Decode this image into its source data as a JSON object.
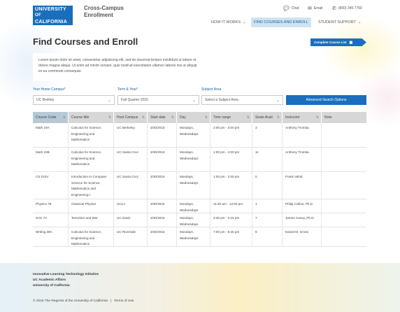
{
  "header": {
    "logo_line1": "UNIVERSITY",
    "logo_line2": "OF",
    "logo_line3": "CALIFORNIA",
    "site_title": "Cross-Campus Enrollment",
    "utility": {
      "chat": "Chat",
      "email": "Email",
      "phone": "(800) 345 7760"
    },
    "nav": [
      {
        "label": "HOW IT WORKS"
      },
      {
        "label": "FIND COURSES AND ENROLL"
      },
      {
        "label": "STUDENT SUPPORT"
      }
    ]
  },
  "page_title": "Find Courses and Enroll",
  "complete_course_list_label": "Complete Course List",
  "intro_text": "Lorem ipsum dolor sit amet, consectetur adipisicing elit, sed do eiusmod tempor incididunt ut labore et dolore magna aliqua. Ut enim ad minim veniam, quis nostrud exercitation ullamco laboris nisi ut aliquip ex ea commodo consequat.",
  "filters": {
    "home_campus": {
      "label": "Your Home Campus*",
      "value": "UC Berkley"
    },
    "term_year": {
      "label": "Term & Year*",
      "value": "Fall Quarter 2015"
    },
    "subject_area": {
      "label": "Subject Area",
      "value": "Select a Subject Area"
    },
    "advanced_search_label": "Advanced Search Options"
  },
  "table": {
    "headers": [
      "Course Code",
      "Course title",
      "Host Campus",
      "Start date",
      "Day",
      "Time range",
      "Seats Avail.",
      "Instructor",
      "Note"
    ],
    "rows": [
      [
        "Math 19A",
        "Calculus for Science, Engineering and Mathematics",
        "UC Berkeley",
        "3/30/2015",
        "Mondays, Wednesdays",
        "2:00 pm - 3:00 pm",
        "3",
        "Anthony Tromba",
        ""
      ],
      [
        "Math 19B",
        "Calculus for Science, Engineering and Mathematics",
        "UC Santa Cruz",
        "3/30/2015",
        "Mondays, Wednesdays",
        "1:00 pm - 4:00 pm",
        "11",
        "Anthony Tromba",
        ""
      ],
      [
        "CS 010V",
        "Introduction to Computer Science for Science, Mathematics and Engineering I",
        "UC Santa Cruz",
        "3/30/2015",
        "Mondays, Wednesdays",
        "1:00 pm - 2:00 pm",
        "5",
        "Frank Vahid",
        ""
      ],
      [
        "Physics 7E",
        "Classical Physics",
        "UCLA",
        "3/30/2015",
        "Mondays, Wednesdays",
        "11:30 am - 12:00 pm",
        "1",
        "Philip Collins, Ph.D",
        ""
      ],
      [
        "SAS 7V",
        "Terrorism and War",
        "UC Davis",
        "3/30/2015",
        "Mondays, Wednesdays",
        "3:30 pm - 4:15 pm",
        "7",
        "James Caney, Ph.D.",
        ""
      ],
      [
        "Writing 39A",
        "Calculus for Science, Engineering and Mathematics",
        "UC Riverside",
        "3/30/2015",
        "Mondays, Wednesdays",
        "7:00 pm - 8:45 pm",
        "6",
        "Daniel M. Gross",
        ""
      ]
    ]
  },
  "footer": {
    "org_lines": [
      "Innovative Learning Technology Initiative",
      "UC Academic Affairs",
      "University of California"
    ],
    "copyright": "© 2015 The Regents of the University of California",
    "separator": "|",
    "terms": "Terms of Use"
  },
  "colors": {
    "brand_blue": "#1a6ebd",
    "nav_active_bg": "#cfe3f2"
  }
}
